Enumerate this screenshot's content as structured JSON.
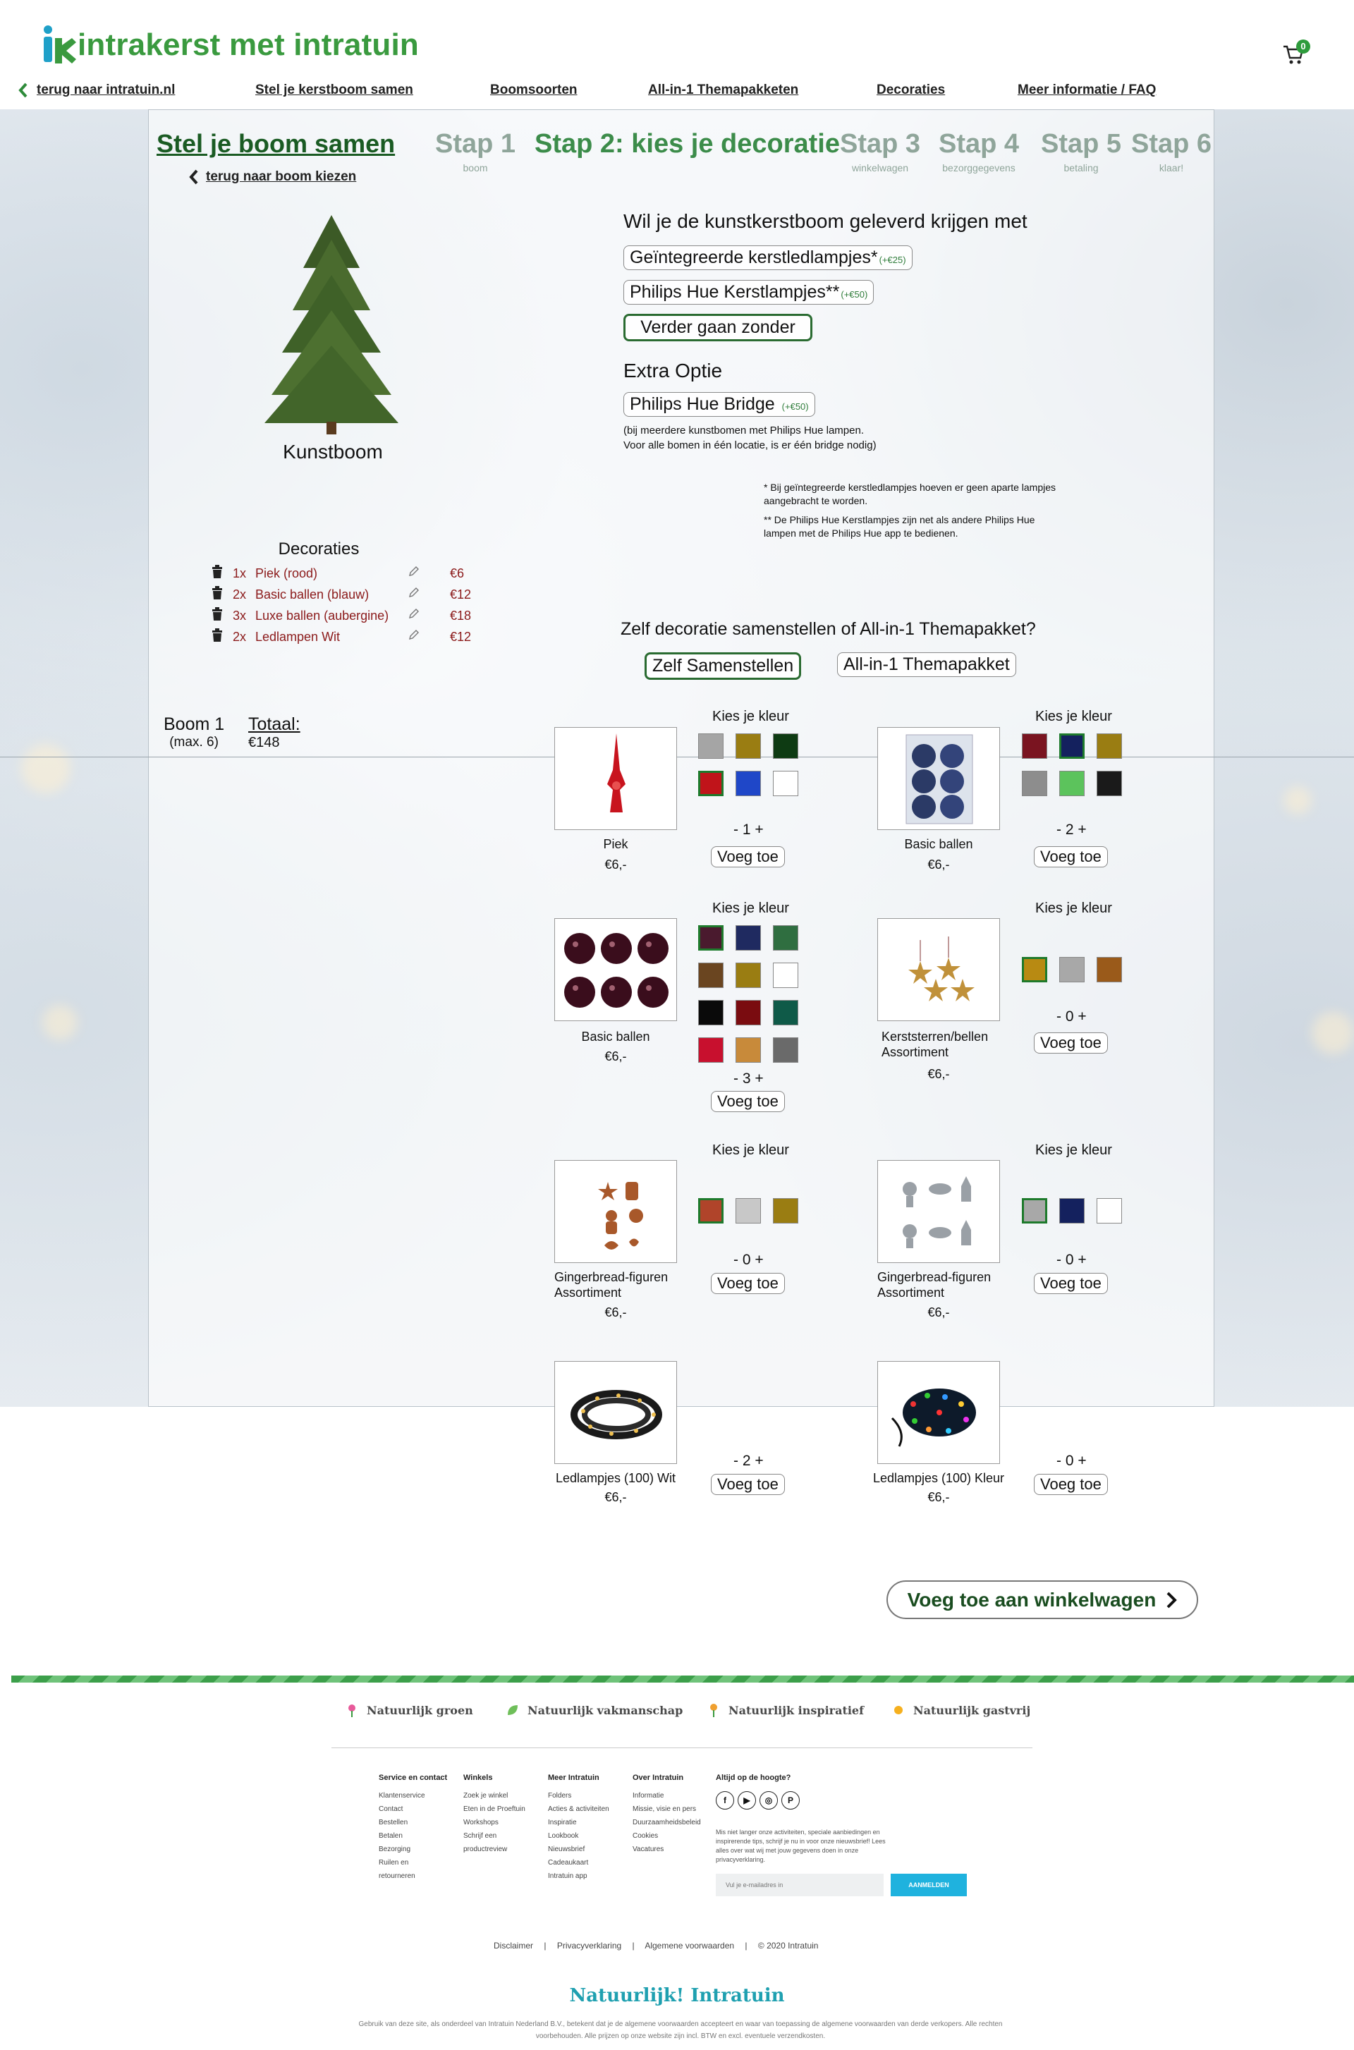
{
  "header": {
    "logo_text": "intrakerst met intratuin",
    "cart_count": "0"
  },
  "nav": {
    "back": "terug naar intratuin.nl",
    "items": [
      "Stel je kerstboom samen",
      "Boomsoorten",
      "All-in-1 Themapakketen",
      "Decoraties",
      "Meer informatie / FAQ"
    ]
  },
  "steps": {
    "title": "Stel je boom samen",
    "back_link": "terug naar boom kiezen",
    "step1": "Stap 1",
    "step1_sub": "boom",
    "step2": "Stap 2: kies je decoratie",
    "step3": "Stap 3",
    "step3_sub": "winkelwagen",
    "step4": "Stap 4",
    "step4_sub": "bezorggegevens",
    "step5": "Stap 5",
    "step5_sub": "betaling",
    "step6": "Stap 6",
    "step6_sub": "klaar!"
  },
  "tree": {
    "label": "Kunstboom"
  },
  "options": {
    "question": "Wil je de kunstkerstboom geleverd krijgen met",
    "opt1": "Geïntegreerde kerstledlampjes*",
    "opt1_price": "(+€25)",
    "opt2": "Philips Hue Kerstlampjes**",
    "opt2_price": "(+€50)",
    "opt3": "Verder gaan zonder",
    "extra_title": "Extra Optie",
    "extra_btn": "Philips Hue Bridge",
    "extra_price": "(+€50)",
    "extra_note_1": "(bij meerdere kunstbomen met Philips Hue lampen.",
    "extra_note_2": "Voor alle bomen in één locatie, is er één bridge nodig)",
    "footnote1": "* Bij geïntegreerde kerstledlampjes hoeven er geen aparte lampjes aangebracht te worden.",
    "footnote2": "** De Philips Hue Kerstlampjes zijn net als andere Philips Hue lampen met de Philips Hue app te bedienen."
  },
  "decorations": {
    "title": "Decoraties",
    "items": [
      {
        "qty": "1x",
        "name": "Piek (rood)",
        "price": "€6"
      },
      {
        "qty": "2x",
        "name": "Basic ballen (blauw)",
        "price": "€12"
      },
      {
        "qty": "3x",
        "name": "Luxe ballen (aubergine)",
        "price": "€18"
      },
      {
        "qty": "2x",
        "name": "Ledlampen Wit",
        "price": "€12"
      }
    ]
  },
  "mode": {
    "question": "Zelf decoratie samenstellen of All-in-1 Themapakket?",
    "self": "Zelf Samenstellen",
    "theme": "All-in-1 Themapakket"
  },
  "summary": {
    "boom": "Boom 1",
    "boom_max": "(max. 6)",
    "total_label": "Totaal:",
    "total_value": "€148"
  },
  "products": {
    "kies": "Kies je kleur",
    "add": "Voeg toe",
    "p1": {
      "name": "Piek",
      "price": "€6,-",
      "qty": "- 1 +"
    },
    "p2": {
      "name": "Basic ballen",
      "price": "€6,-",
      "qty": "- 2 +"
    },
    "p3": {
      "name": "Basic ballen",
      "price": "€6,-",
      "qty": "- 3 +"
    },
    "p4": {
      "name": "Kerststerren/bellen Assortiment",
      "price": "€6,-",
      "qty": "- 0 +"
    },
    "p5": {
      "name": "Gingerbread-figuren Assortiment",
      "price": "€6,-",
      "qty": "- 0 +"
    },
    "p6": {
      "name": "Gingerbread-figuren Assortiment",
      "price": "€6,-",
      "qty": "- 0 +"
    },
    "p7": {
      "name": "Ledlampjes (100) Wit",
      "price": "€6,-",
      "qty": "- 2 +"
    },
    "p8": {
      "name": "Ledlampjes (100) Kleur",
      "price": "€6,-",
      "qty": "- 0 +"
    }
  },
  "swatches": {
    "p1": [
      "#a5a5a5",
      "#9a7d12",
      "#0e3b13",
      "#c0141a",
      "#1f47c8",
      "#ffffff"
    ],
    "p2": [
      "#7a1420",
      "#14215e",
      "#9a7d12",
      "#8d8d8d",
      "#5cc35c",
      "#1a1a1a"
    ],
    "p3": [
      "#4a1a2e",
      "#1f2a60",
      "#2f6e40",
      "#6a4520",
      "#9a7d12",
      "#ffffff",
      "#0a0a0a",
      "#7a0c10",
      "#0f5a48",
      "#c8102e",
      "#c88a3a",
      "#6a6a6a"
    ],
    "p4": [
      "#b88a12",
      "#a8a8a8",
      "#9a5a1a"
    ],
    "p5": [
      "#b0442a",
      "#c8c8c8",
      "#9a7d12"
    ],
    "p6": [
      "#a8a8a8",
      "#14215e",
      "#ffffff"
    ]
  },
  "cta": {
    "label": "Voeg toe aan winkelwagen"
  },
  "footer": {
    "values": [
      "Natuurlijk groen",
      "Natuurlijk vakmanschap",
      "Natuurlijk inspiratief",
      "Natuurlijk gastvrij"
    ],
    "col1": {
      "title": "Service en contact",
      "items": [
        "Klantenservice",
        "Contact",
        "Bestellen",
        "Betalen",
        "Bezorging",
        "Ruilen en",
        "retourneren"
      ]
    },
    "col2": {
      "title": "Winkels",
      "items": [
        "Zoek je winkel",
        "Eten in de Proeftuin",
        "Workshops",
        "Schrijf een",
        "productreview"
      ]
    },
    "col3": {
      "title": "Meer Intratuin",
      "items": [
        "Folders",
        "Acties & activiteiten",
        "Inspiratie",
        "Lookbook",
        "Nieuwsbrief",
        "Cadeaukaart",
        "Intratuin app"
      ]
    },
    "col4": {
      "title": "Over Intratuin",
      "items": [
        "Informatie",
        "Missie, visie en pers",
        "Duurzaamheidsbeleid",
        "Cookies",
        "Vacatures"
      ]
    },
    "newsletter_title": "Altijd op de hoogte?",
    "newsletter_text": "Mis niet langer onze activiteiten, speciale aanbiedingen en inspirerende tips, schrijf je nu in voor onze nieuwsbrief! Lees alles over wat wij met jouw gegevens doen in onze privacyverklaring.",
    "newsletter_placeholder": "Vul je e-mailadres in",
    "newsletter_button": "AANMELDEN",
    "legal": [
      "Disclaimer",
      "Privacyverklaring",
      "Algemene voorwaarden",
      "© 2020 Intratuin"
    ],
    "brand": "Natuurlijk! Intratuin",
    "disclaimer": "Gebruik van deze site, als onderdeel van Intratuin Nederland B.V., betekent dat je de algemene voorwaarden accepteert en waar van toepassing de algemene voorwaarden van derde verkopers. Alle rechten voorbehouden. Alle prijzen op onze website zijn incl. BTW en excl. eventuele verzendkosten."
  }
}
